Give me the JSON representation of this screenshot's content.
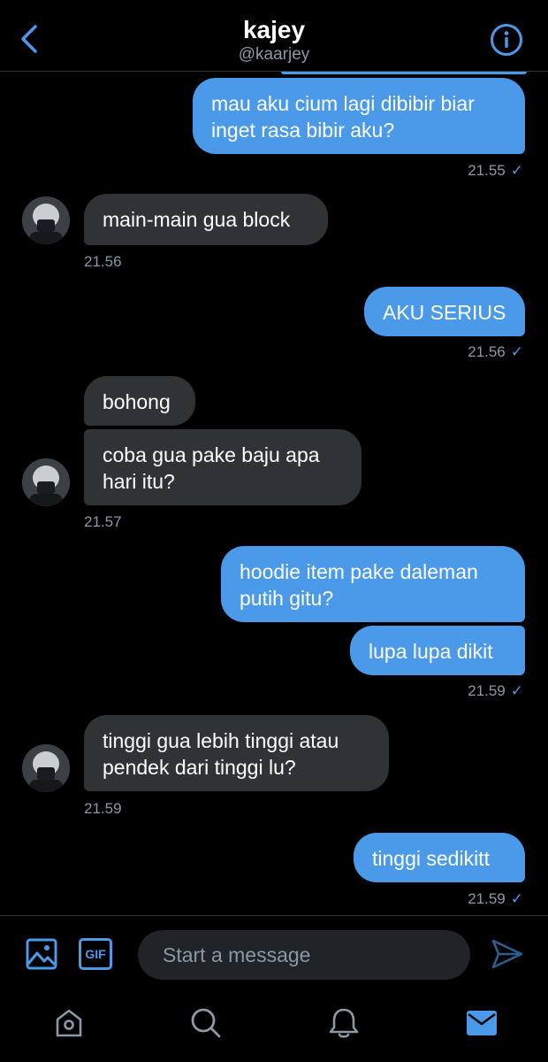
{
  "header": {
    "title": "kajey",
    "handle": "@kaarjey",
    "back_icon": "chevron-left-icon",
    "info_icon": "info-icon"
  },
  "messages": [
    {
      "side": "sent",
      "text": "mau aku cium lagi dibibir biar\ninget rasa bibir aku?"
    },
    {
      "side": "sent",
      "time": "21.55",
      "read_icon": "✓"
    },
    {
      "side": "recv",
      "text": "main-main gua block"
    },
    {
      "side": "recv",
      "time": "21.56"
    },
    {
      "side": "sent",
      "text": "AKU SERIUS"
    },
    {
      "side": "sent",
      "time": "21.56",
      "read_icon": "✓"
    },
    {
      "side": "recv",
      "text": "bohong"
    },
    {
      "side": "recv",
      "text": "coba gua pake baju apa\nhari itu?"
    },
    {
      "side": "recv",
      "time": "21.57"
    },
    {
      "side": "sent",
      "text": "hoodie item pake daleman\nputih gitu?"
    },
    {
      "side": "sent",
      "text": "lupa lupa dikit"
    },
    {
      "side": "sent",
      "time": "21.59",
      "read_icon": "✓"
    },
    {
      "side": "recv",
      "text": "tinggi gua lebih tinggi atau\npendek dari tinggi lu?"
    },
    {
      "side": "recv",
      "time": "21.59"
    },
    {
      "side": "sent",
      "text": "tinggi sedikitt"
    },
    {
      "side": "sent",
      "time": "21.59",
      "read_icon": "✓"
    }
  ],
  "composer": {
    "placeholder": "Start a message",
    "gif_label": "GIF",
    "image_icon": "image-icon",
    "send_icon": "send-icon"
  },
  "tabbar": {
    "items": [
      "home-icon",
      "search-icon",
      "notifications-icon",
      "messages-icon"
    ],
    "active": "messages-icon"
  },
  "colors": {
    "accent": "#4a9ae9",
    "received_bubble": "#2f3336",
    "background": "#000000",
    "secondary_text": "#8b98a5"
  }
}
